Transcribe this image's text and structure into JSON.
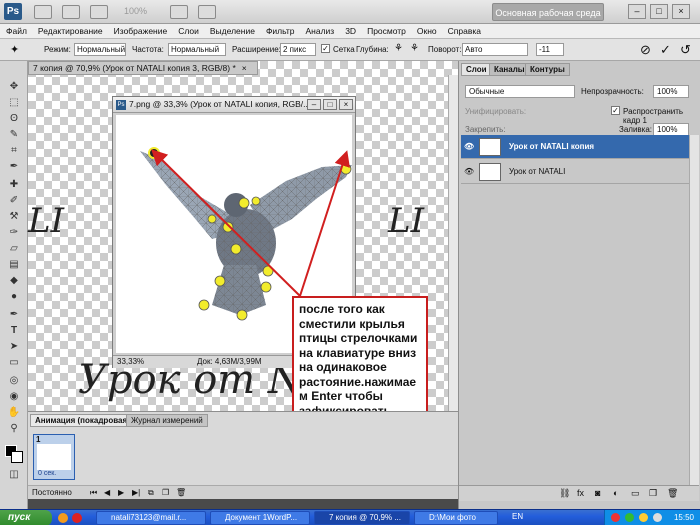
{
  "app": {
    "logo": "Ps",
    "zoom_readout": "100%",
    "workspace_button": "Основная рабочая среда"
  },
  "menu": [
    "Файл",
    "Редактирование",
    "Изображение",
    "Слои",
    "Выделение",
    "Фильтр",
    "Анализ",
    "3D",
    "Просмотр",
    "Окно",
    "Справка"
  ],
  "options": {
    "mode_label": "Режим:",
    "mode_value": "Нормальный",
    "freq_label": "Частота:",
    "freq_value": "Нормальный",
    "expand_label": "Расширение:",
    "expand_value": "2 пикс",
    "grid_label": "Сетка",
    "depth_label": "Глубина:",
    "rotate_label": "Поворот:",
    "rotate_value": "Авто",
    "angle_value": "-11"
  },
  "document": {
    "tab_title": "7 копия @ 70,9% (Урок от NATALI копия 3, RGB/8) *",
    "tab_close": "×",
    "text_left": "LI",
    "text_right": "LI",
    "text_bottom": "Урок от N   A   I"
  },
  "inner_window": {
    "title": "7.png @ 33,3% (Урок от  NATALI копия, RGB/...",
    "zoom": "33,33%",
    "doc_info": "Док: 4,63M/3,99M"
  },
  "note": {
    "text": "после того как сместили крылья птицы стрелочками на клавиатуре вниз на одинаковое растояние.нажимае м Enter  чтобы зафиксировать движение"
  },
  "animation": {
    "tab_animation": "Анимация (покадровая)",
    "tab_history": "Журнал измерений",
    "frame_number": "1",
    "frame_delay": "0 сек.",
    "loop_label": "Постоянно"
  },
  "layers_panel": {
    "tab_layers": "Слои",
    "tab_channels": "Каналы",
    "tab_paths": "Контуры",
    "blend_mode": "Обычные",
    "opacity_label": "Непрозрачность:",
    "opacity_value": "100%",
    "unify_label": "Унифицировать:",
    "propagate_label": "Распространить кадр 1",
    "lock_label": "Закрепить:",
    "fill_label": "Заливка:",
    "fill_value": "100%",
    "layers": [
      {
        "name": "Урок от  NATALI копия",
        "selected": true
      },
      {
        "name": "Урок от  NATALI",
        "selected": false
      }
    ]
  },
  "taskbar": {
    "start": "пуск",
    "buttons": [
      "natali73123@mail.r...",
      "Документ 1WordP...",
      "7 копия @ 70,9% ...",
      "D:\\Мои фото"
    ],
    "lang": "EN",
    "time": "15:50"
  },
  "colors": {
    "accent": "#3469ad",
    "annotation_border": "#c81e1e",
    "marker": "#f2ec2c",
    "arrow": "#d11f1f"
  }
}
